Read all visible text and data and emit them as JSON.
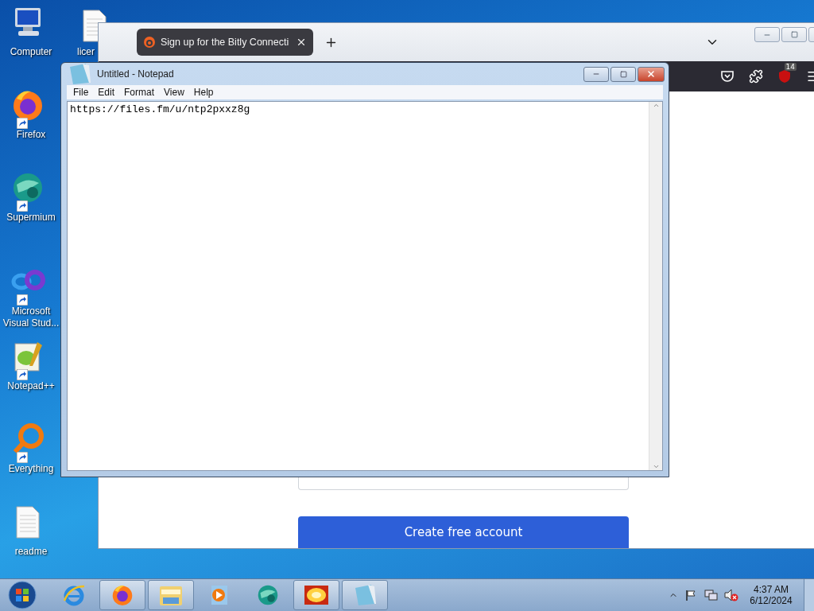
{
  "desktop_icons": [
    {
      "kind": "computer",
      "label": "Computer",
      "shortcut": false
    },
    {
      "kind": "firefox",
      "label": "Firefox",
      "shortcut": true
    },
    {
      "kind": "supermium",
      "label": "Supermium",
      "shortcut": true
    },
    {
      "kind": "vs",
      "label": "Microsoft Visual Stud...",
      "shortcut": true
    },
    {
      "kind": "notepadpp",
      "label": "Notepad++",
      "shortcut": true
    },
    {
      "kind": "everything",
      "label": "Everything",
      "shortcut": true
    },
    {
      "kind": "document",
      "label": "readme",
      "shortcut": false
    }
  ],
  "desktop_icon_partial": {
    "kind": "document",
    "label": "licer"
  },
  "browser": {
    "tab_title": "Sign up for the Bitly Connecti",
    "extension_badge": "14",
    "submit_button": "Create free account"
  },
  "notepad": {
    "title": "Untitled - Notepad",
    "menu": [
      "File",
      "Edit",
      "Format",
      "View",
      "Help"
    ],
    "content": "https://files.fm/u/ntp2pxxz8g"
  },
  "taskbar": {
    "items": [
      {
        "kind": "ie",
        "running": false
      },
      {
        "kind": "firefox",
        "running": true
      },
      {
        "kind": "explorer",
        "running": true
      },
      {
        "kind": "media",
        "running": false
      },
      {
        "kind": "supermium",
        "running": false
      },
      {
        "kind": "image",
        "running": true
      },
      {
        "kind": "notepad",
        "running": true
      }
    ],
    "clock": {
      "time": "4:37 AM",
      "date": "6/12/2024"
    }
  }
}
